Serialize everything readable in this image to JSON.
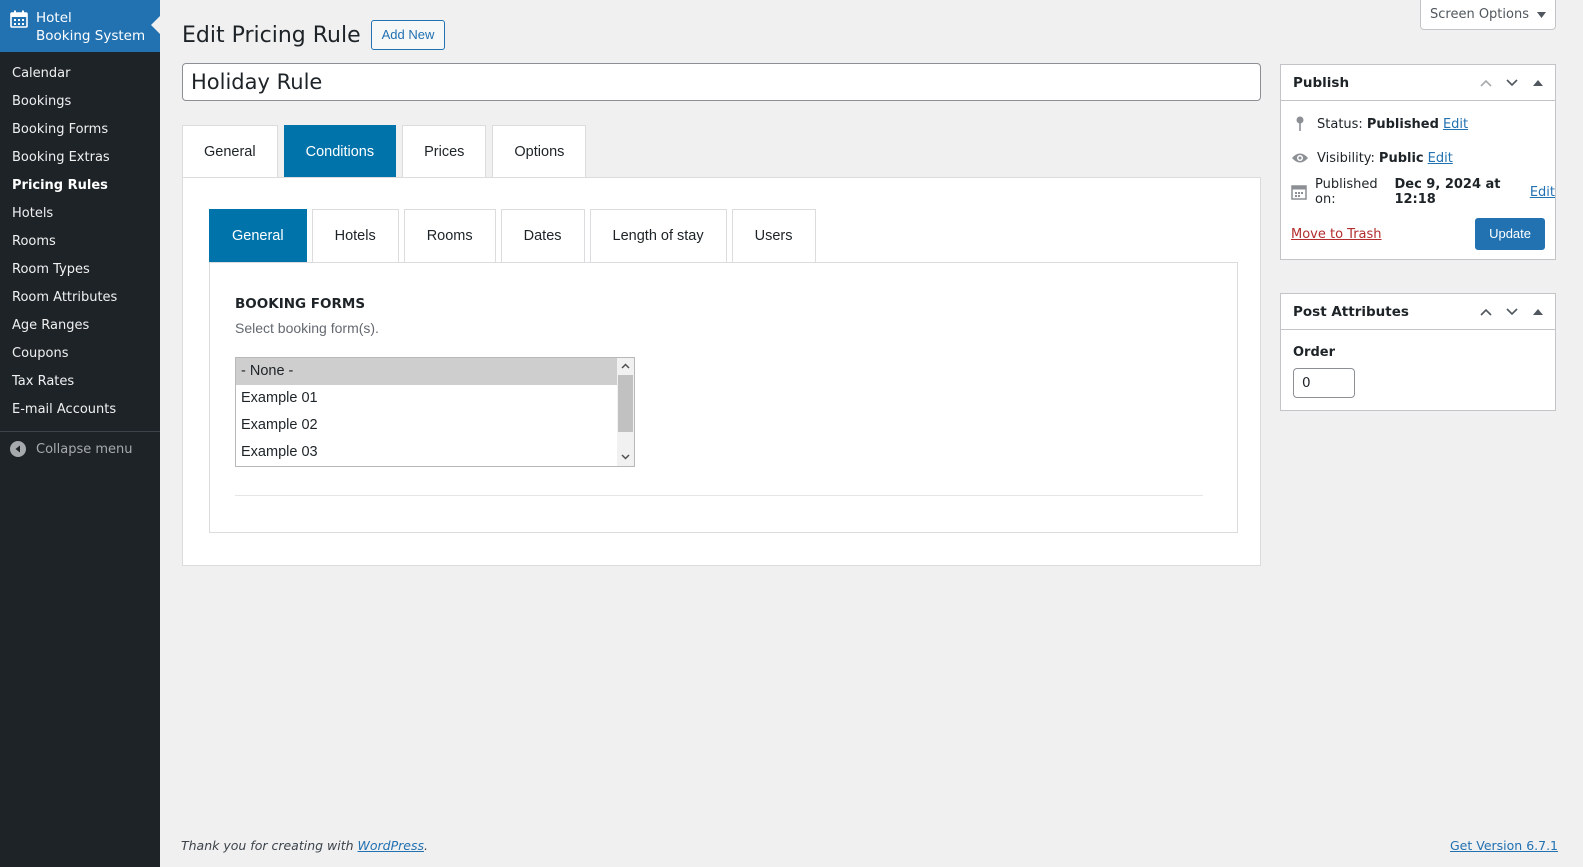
{
  "sidebar": {
    "brand": {
      "line1": "Hotel",
      "line2": "Booking System",
      "icon": "calendar-icon"
    },
    "items": [
      {
        "label": "Calendar"
      },
      {
        "label": "Bookings"
      },
      {
        "label": "Booking Forms"
      },
      {
        "label": "Booking Extras"
      },
      {
        "label": "Pricing Rules",
        "current": true
      },
      {
        "label": "Hotels"
      },
      {
        "label": "Rooms"
      },
      {
        "label": "Room Types"
      },
      {
        "label": "Room Attributes"
      },
      {
        "label": "Age Ranges"
      },
      {
        "label": "Coupons"
      },
      {
        "label": "Tax Rates"
      },
      {
        "label": "E-mail Accounts"
      }
    ],
    "collapse_label": "Collapse menu"
  },
  "screen_options": {
    "label": "Screen Options"
  },
  "page": {
    "title": "Edit Pricing Rule",
    "add_new_label": "Add New",
    "post_title": "Holiday Rule"
  },
  "main_tabs": [
    {
      "label": "General"
    },
    {
      "label": "Conditions",
      "active": true
    },
    {
      "label": "Prices"
    },
    {
      "label": "Options"
    }
  ],
  "sub_tabs": [
    {
      "label": "General",
      "active": true
    },
    {
      "label": "Hotels"
    },
    {
      "label": "Rooms"
    },
    {
      "label": "Dates"
    },
    {
      "label": "Length of stay"
    },
    {
      "label": "Users"
    }
  ],
  "booking_forms": {
    "title": "BOOKING FORMS",
    "description": "Select booking form(s).",
    "options": [
      {
        "label": "- None -",
        "selected": true
      },
      {
        "label": "Example 01"
      },
      {
        "label": "Example 02"
      },
      {
        "label": "Example 03"
      }
    ]
  },
  "publish": {
    "title": "Publish",
    "status_label": "Status:",
    "status_value": "Published",
    "visibility_label": "Visibility:",
    "visibility_value": "Public",
    "published_on_label": "Published on:",
    "published_on_value": "Dec 9, 2024 at 12:18",
    "edit_label": "Edit",
    "trash_label": "Move to Trash",
    "update_label": "Update"
  },
  "post_attributes": {
    "title": "Post Attributes",
    "order_label": "Order",
    "order_value": "0"
  },
  "footer": {
    "thanks_prefix": "Thank you for creating with ",
    "wordpress_link": "WordPress",
    "thanks_suffix": ".",
    "version_link": "Get Version 6.7.1"
  },
  "colors": {
    "accent": "#2271b1",
    "tab_active": "#0073aa",
    "sidebar_bg": "#1d2327",
    "trash": "#b32d2e"
  }
}
